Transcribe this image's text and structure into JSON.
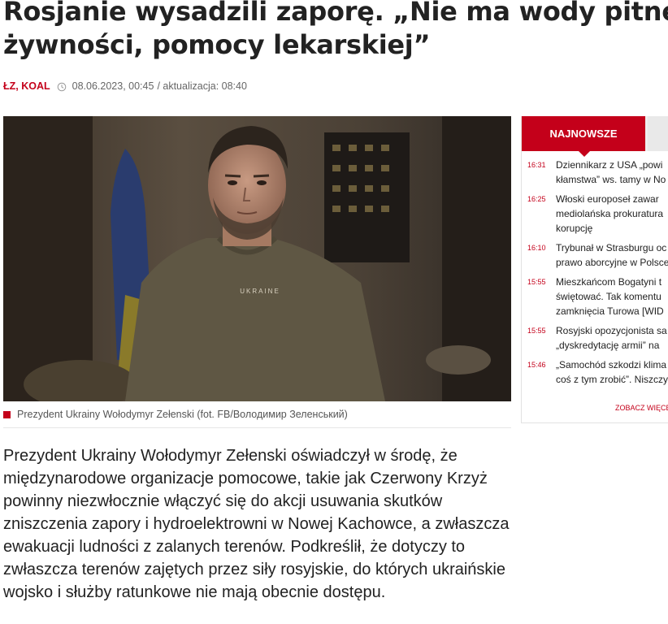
{
  "article": {
    "headline_line1": "Rosjanie wysadzili zaporę. „Nie ma wody pitnej,",
    "headline_line2": "żywności, pomocy lekarskiej”",
    "authors": "ŁZ, KOAL",
    "date": "08.06.2023, 00:45",
    "updated": "/ aktualizacja: 08:40",
    "photo_text": "UKRAINE",
    "caption": "Prezydent Ukrainy Wołodymyr Zełenski (fot. FB/Володимир Зеленський)",
    "lead": "Prezydent Ukrainy Wołodymyr Zełenski oświadczył w środę, że międzynarodowe organizacje pomocowe, takie jak Czerwony Krzyż powinny niezwłocznie włączyć się do akcji usuwania skutków zniszczenia zapory i hydroelektrowni w Nowej Kachowce, a zwłaszcza ewakuacji ludności z zalanych terenów. Podkreślił, że dotyczy to zwłaszcza terenów zajętych przez siły rosyjskie, do których ukraińskie wojsko i służby ratunkowe nie mają obecnie dostępu."
  },
  "sidebar": {
    "tab_label": "NAJNOWSZE",
    "more_label": "ZOBACZ WIĘCE",
    "items": [
      {
        "time": "16:31",
        "title": "Dziennikarz z USA „powi\nkłamstwa” ws. tamy w No"
      },
      {
        "time": "16:25",
        "title": "Włoski europoseł zawar\nmediolańska prokuratura\nkorupcję"
      },
      {
        "time": "16:10",
        "title": "Trybunał w Strasburgu oc\nprawo aborcyjne w Polsce"
      },
      {
        "time": "15:55",
        "title": "Mieszkańcom Bogatyni t\nświętować. Tak komentu\nzamknięcia Turowa [WID"
      },
      {
        "time": "15:55",
        "title": "Rosyjski opozycjonista sa\n„dyskredytację armii” na"
      },
      {
        "time": "15:46",
        "title": "„Samochód szkodzi klima\ncoś z tym zrobić”. Niszczy"
      }
    ]
  },
  "colors": {
    "accent": "#c4001a"
  }
}
